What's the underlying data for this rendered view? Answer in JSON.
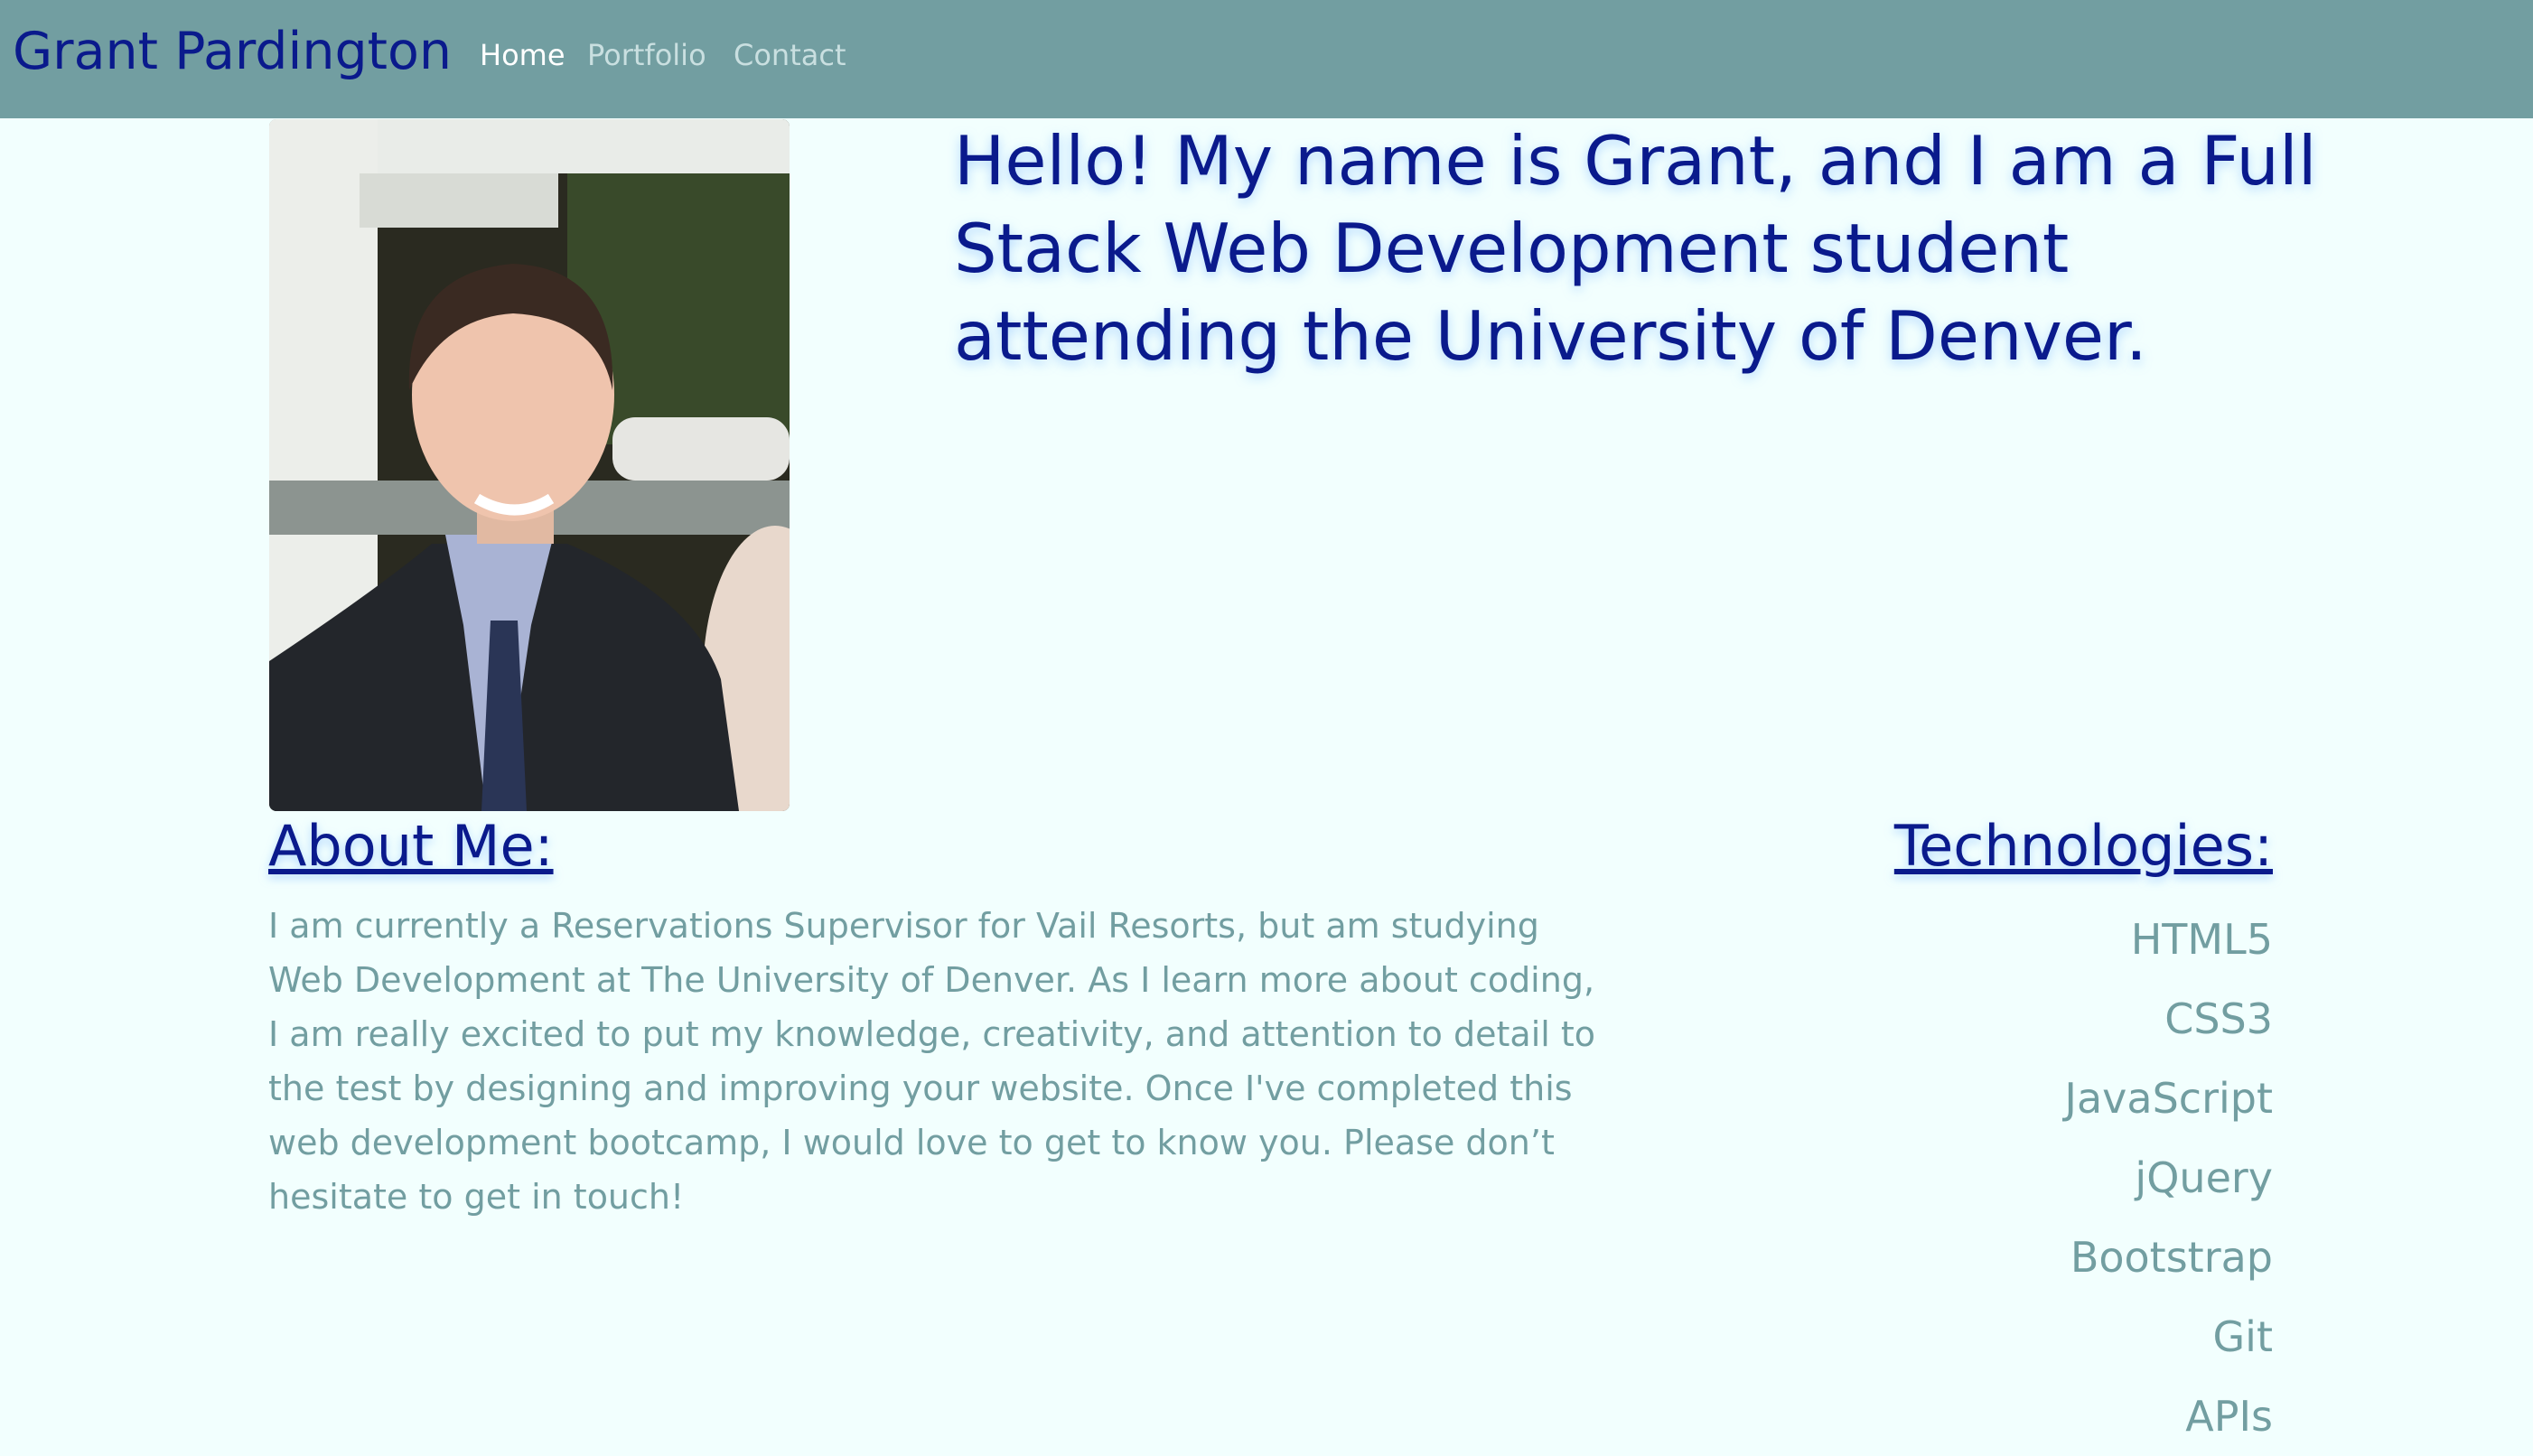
{
  "nav": {
    "brand": "Grant Pardington",
    "links": [
      "Home",
      "Portfolio",
      "Contact"
    ]
  },
  "hero": {
    "heading": "Hello! My name is Grant, and I am a Full Stack Web Development student attending the University of Denver."
  },
  "about": {
    "heading": "About Me:",
    "text": "I am currently a Reservations Supervisor for Vail Resorts, but am studying Web Development at The University of Denver. As I learn more about coding, I am really excited to put my knowledge, creativity, and attention to detail to the test by designing and improving your website. Once I've completed this web development bootcamp, I would love to get to know you. Please don’t hesitate to get in touch!"
  },
  "technologies": {
    "heading": "Technologies:",
    "items": [
      "HTML5",
      "CSS3",
      "JavaScript",
      "jQuery",
      "Bootstrap",
      "Git",
      "APIs"
    ]
  },
  "colors": {
    "navbar": "#729ea1",
    "background": "#f2fffe",
    "heading": "#0a1a8c",
    "body_text": "#729ea1"
  }
}
